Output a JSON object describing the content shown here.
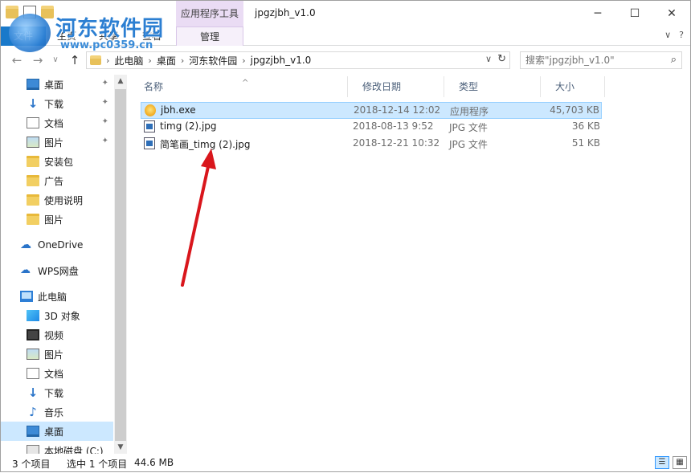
{
  "titlebar": {
    "context_tab": "应用程序工具",
    "title": "jpgzjbh_v1.0",
    "minimize_glyph": "─",
    "maximize_glyph": "☐",
    "close_glyph": "✕"
  },
  "ribbon": {
    "tabs": [
      "文件",
      "主页",
      "共享",
      "查看"
    ],
    "manage_tab": "管理",
    "collapse_glyph": "∨",
    "help_glyph": "?"
  },
  "logo": {
    "text": "河东软件园",
    "url": "www.pc0359.cn"
  },
  "navbar": {
    "back_glyph": "←",
    "forward_glyph": "→",
    "recent_glyph": "∨",
    "up_glyph": "↑",
    "breadcrumb": [
      "此电脑",
      "桌面",
      "河东软件园",
      "jpgzjbh_v1.0"
    ],
    "separator": "›",
    "dropdown_glyph": "∨",
    "refresh_glyph": "↻",
    "search_placeholder": "搜索\"jpgzjbh_v1.0\"",
    "search_glyph": "⌕"
  },
  "sidebar": {
    "pin_glyph": "📌",
    "quick_access": [
      {
        "label": "桌面",
        "icon": "desktop-icon",
        "pinned": true
      },
      {
        "label": "下载",
        "icon": "download-icon",
        "pinned": true
      },
      {
        "label": "文档",
        "icon": "documents-icon",
        "pinned": true
      },
      {
        "label": "图片",
        "icon": "pictures-icon",
        "pinned": true
      },
      {
        "label": "安装包",
        "icon": "folder-icon",
        "pinned": false
      },
      {
        "label": "广告",
        "icon": "folder-icon",
        "pinned": false
      },
      {
        "label": "使用说明",
        "icon": "folder-icon",
        "pinned": false
      },
      {
        "label": "图片",
        "icon": "folder-icon",
        "pinned": false
      }
    ],
    "onedrive": "OneDrive",
    "wps": "WPS网盘",
    "this_pc": "此电脑",
    "pc_items": [
      {
        "label": "3D 对象",
        "icon": "3d-objects-icon"
      },
      {
        "label": "视频",
        "icon": "videos-icon"
      },
      {
        "label": "图片",
        "icon": "pictures-icon"
      },
      {
        "label": "文档",
        "icon": "documents-icon"
      },
      {
        "label": "下载",
        "icon": "download-icon"
      },
      {
        "label": "音乐",
        "icon": "music-icon"
      },
      {
        "label": "桌面",
        "icon": "desktop-icon"
      },
      {
        "label": "本地磁盘 (C:)",
        "icon": "disk-icon"
      }
    ],
    "scroll_up_glyph": "▲",
    "scroll_down_glyph": "▼"
  },
  "filelist": {
    "columns": {
      "name": "名称",
      "date": "修改日期",
      "type": "类型",
      "size": "大小"
    },
    "sort_glyph": "^",
    "rows": [
      {
        "name": "jbh.exe",
        "date": "2018-12-14 12:02",
        "type": "应用程序",
        "size": "45,703 KB",
        "icon": "exe-icon",
        "selected": true
      },
      {
        "name": "timg (2).jpg",
        "date": "2018-08-13 9:52",
        "type": "JPG 文件",
        "size": "36 KB",
        "icon": "jpg-icon",
        "selected": false
      },
      {
        "name": "简笔画_timg (2).jpg",
        "date": "2018-12-21 10:32",
        "type": "JPG 文件",
        "size": "51 KB",
        "icon": "jpg-icon",
        "selected": false
      }
    ]
  },
  "statusbar": {
    "item_count": "3 个项目",
    "selection": "选中 1 个项目",
    "selection_size": "44.6 MB",
    "details_view_glyph": "☰",
    "icons_view_glyph": "▦"
  },
  "colors": {
    "selection": "#cce8ff",
    "context_tab": "#eadcf4",
    "annotation_arrow": "#d9161c"
  }
}
